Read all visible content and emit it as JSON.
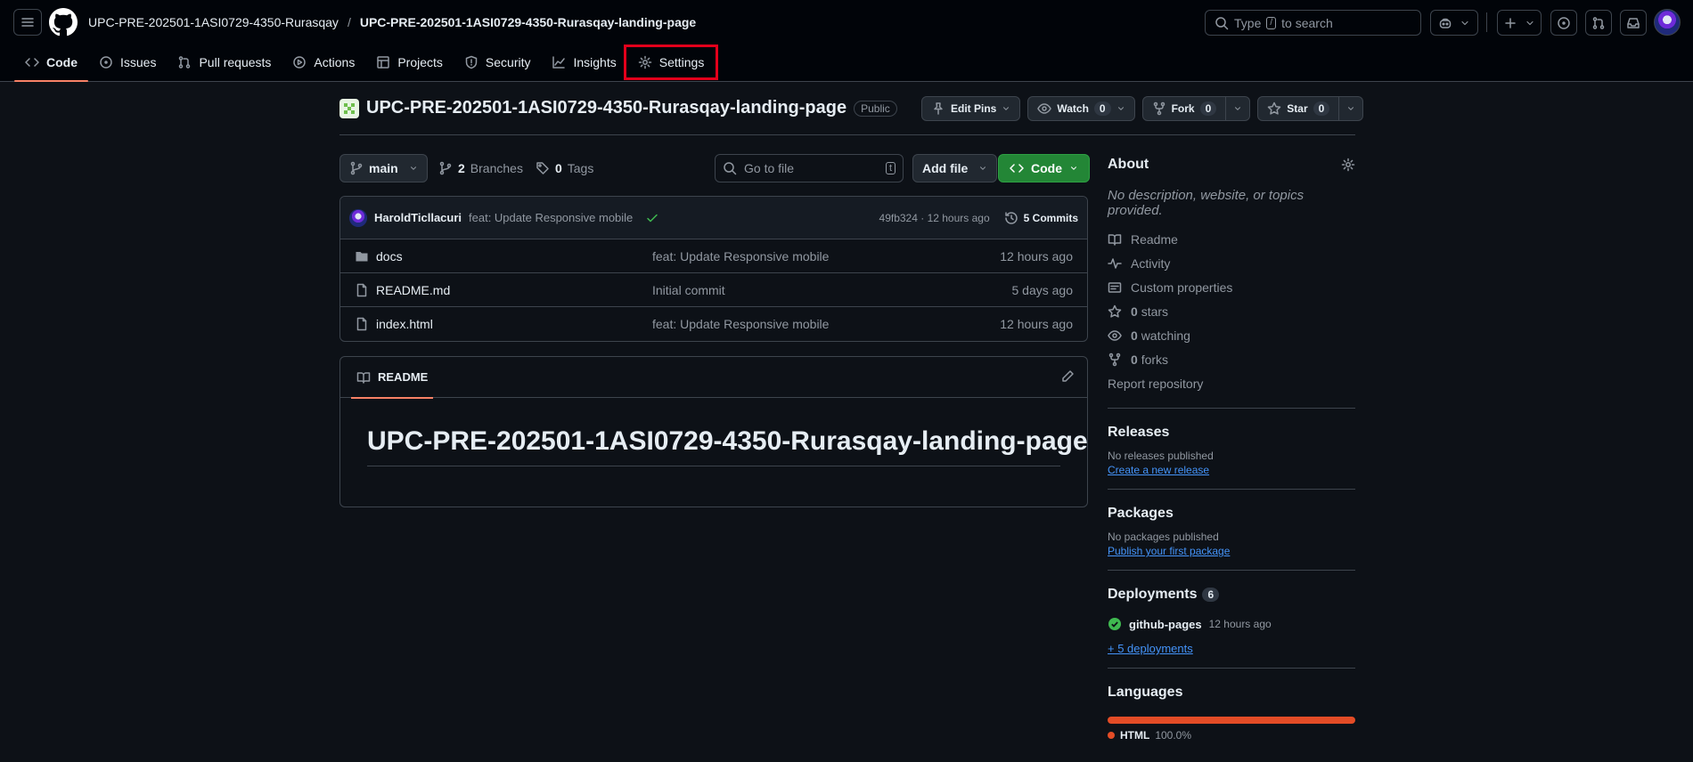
{
  "header": {
    "owner": "UPC-PRE-202501-1ASI0729-4350-Rurasqay",
    "separator": "/",
    "repo": "UPC-PRE-202501-1ASI0729-4350-Rurasqay-landing-page",
    "search_prefix": "Type",
    "search_key": "/",
    "search_suffix": "to search"
  },
  "tabs": [
    {
      "label": "Code",
      "icon": "code-icon"
    },
    {
      "label": "Issues",
      "icon": "issue-icon"
    },
    {
      "label": "Pull requests",
      "icon": "pull-request-icon"
    },
    {
      "label": "Actions",
      "icon": "play-icon"
    },
    {
      "label": "Projects",
      "icon": "table-icon"
    },
    {
      "label": "Security",
      "icon": "shield-icon"
    },
    {
      "label": "Insights",
      "icon": "graph-icon"
    },
    {
      "label": "Settings",
      "icon": "gear-icon"
    }
  ],
  "repo": {
    "title": "UPC-PRE-202501-1ASI0729-4350-Rurasqay-landing-page",
    "visibility": "Public",
    "edit_pins": "Edit Pins",
    "watch": "Watch",
    "watch_count": "0",
    "fork": "Fork",
    "fork_count": "0",
    "star": "Star",
    "star_count": "0"
  },
  "filenav": {
    "branch": "main",
    "branches_count": "2",
    "branches_label": "Branches",
    "tags_count": "0",
    "tags_label": "Tags",
    "goto_placeholder": "Go to file",
    "goto_key": "t",
    "add_file": "Add file",
    "code": "Code"
  },
  "commit": {
    "author": "HaroldTicllacuri",
    "message": "feat: Update Responsive mobile",
    "hash_time": "49fb324 · 12 hours ago",
    "count": "5 Commits"
  },
  "files": [
    {
      "name": "docs",
      "type": "folder",
      "message": "feat: Update Responsive mobile",
      "time": "12 hours ago"
    },
    {
      "name": "README.md",
      "type": "file",
      "message": "Initial commit",
      "time": "5 days ago"
    },
    {
      "name": "index.html",
      "type": "file",
      "message": "feat: Update Responsive mobile",
      "time": "12 hours ago"
    }
  ],
  "readme": {
    "tab": "README",
    "heading": "UPC-PRE-202501-1ASI0729-4350-Rurasqay-landing-page"
  },
  "sidebar": {
    "about_title": "About",
    "description": "No description, website, or topics provided.",
    "items": [
      {
        "icon": "book-icon",
        "label": "Readme",
        "count": ""
      },
      {
        "icon": "pulse-icon",
        "label": "Activity",
        "count": ""
      },
      {
        "icon": "note-icon",
        "label": "Custom properties",
        "count": ""
      },
      {
        "icon": "star-icon",
        "label": "stars",
        "count": "0"
      },
      {
        "icon": "eye-icon",
        "label": "watching",
        "count": "0"
      },
      {
        "icon": "fork-icon",
        "label": "forks",
        "count": "0"
      }
    ],
    "report": "Report repository",
    "releases_title": "Releases",
    "releases_empty": "No releases published",
    "releases_link": "Create a new release",
    "packages_title": "Packages",
    "packages_empty": "No packages published",
    "packages_link": "Publish your first package",
    "deployments_title": "Deployments",
    "deployments_count": "6",
    "deployment_name": "github-pages",
    "deployment_time": "12 hours ago",
    "deployments_more": "+ 5 deployments",
    "languages_title": "Languages",
    "language_name": "HTML",
    "language_percent": "100.0%",
    "language_fraction": 1.0,
    "language_color": "#e34c26"
  },
  "colors": {
    "background": "#0d1117",
    "header_bg": "#010409",
    "border": "#3d444d",
    "accent_tab": "#f78166",
    "primary_button": "#238636",
    "link": "#4493f8",
    "highlight_box": "#e3001b"
  }
}
